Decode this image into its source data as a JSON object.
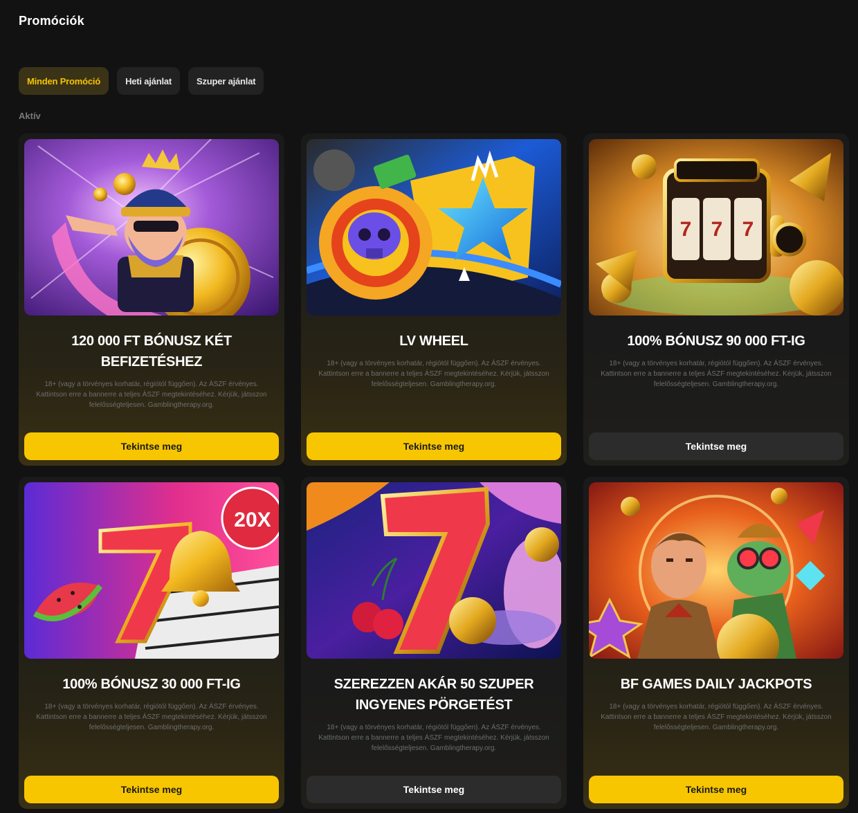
{
  "header": {
    "title": "Promóciók"
  },
  "tabs": [
    {
      "label": "Minden Promóció",
      "active": true
    },
    {
      "label": "Heti ajánlat",
      "active": false
    },
    {
      "label": "Szuper ajánlat",
      "active": false
    }
  ],
  "section": {
    "label": "Aktív"
  },
  "cards": [
    {
      "title": "120 000 Ft BÓNUSZ KÉT BEFIZETÉSHEZ",
      "disclaimer": "18+ (vagy a törvényes korhatár, régiótól függően). Az ÁSZF érvényes. Kattintson erre a bannerre a teljes ÁSZF megtekintéséhez. Kérjük, játsszon felelősségteljesen. Gamblingtherapy.org.",
      "button": "Tekintse meg",
      "button_style": "yellow",
      "image": "king-character-with-coin"
    },
    {
      "title": "LV WHEEL",
      "disclaimer": "18+ (vagy a törvényes korhatár, régiótól függően). Az ÁSZF érvényes. Kattintson erre a bannerre a teljes ÁSZF megtekintéséhez. Kérjük, játsszon felelősségteljesen. Gamblingtherapy.org.",
      "button": "Tekintse meg",
      "button_style": "yellow",
      "image": "skull-and-star-graffiti"
    },
    {
      "title": "100% BÓNUSZ 90 000 FT-IG",
      "disclaimer": "18+ (vagy a törvényes korhatár, régiótól függően). Az ÁSZF érvényes. Kattintson erre a bannerre a teljes ÁSZF megtekintéséhez. Kérjük, játsszon felelősségteljesen. Gamblingtherapy.org.",
      "button": "Tekintse meg",
      "button_style": "dark",
      "image": "golden-slot-machine"
    },
    {
      "title": "100% BÓNUSZ 30 000 Ft-IG",
      "disclaimer": "18+ (vagy a törvényes korhatár, régiótól függően). Az ÁSZF érvényes. Kattintson erre a bannerre a teljes ÁSZF megtekintéséhez. Kérjük, játsszon felelősségteljesen. Gamblingtherapy.org.",
      "button": "Tekintse meg",
      "button_style": "yellow",
      "image": "seven-bell-watermelon",
      "badge": "20X"
    },
    {
      "title": "SZEREZZEN AKÁR 50 SZUPER INGYENES PÖRGETÉST",
      "disclaimer": "18+ (vagy a törvényes korhatár, régiótól függően). Az ÁSZF érvényes. Kattintson erre a bannerre a teljes ÁSZF megtekintéséhez. Kérjük, játsszon felelősségteljesen. Gamblingtherapy.org.",
      "button": "Tekintse meg",
      "button_style": "dark",
      "image": "seven-with-cherries"
    },
    {
      "title": "BF GAMES DAILY JACKPOTS",
      "disclaimer": "18+ (vagy a törvényes korhatár, régiótól függően). Az ÁSZF érvényes. Kattintson erre a bannerre a teljes ÁSZF megtekintéséhez. Kérjük, játsszon felelősségteljesen. Gamblingtherapy.org.",
      "button": "Tekintse meg",
      "button_style": "yellow",
      "image": "explorer-and-goblin"
    }
  ]
}
